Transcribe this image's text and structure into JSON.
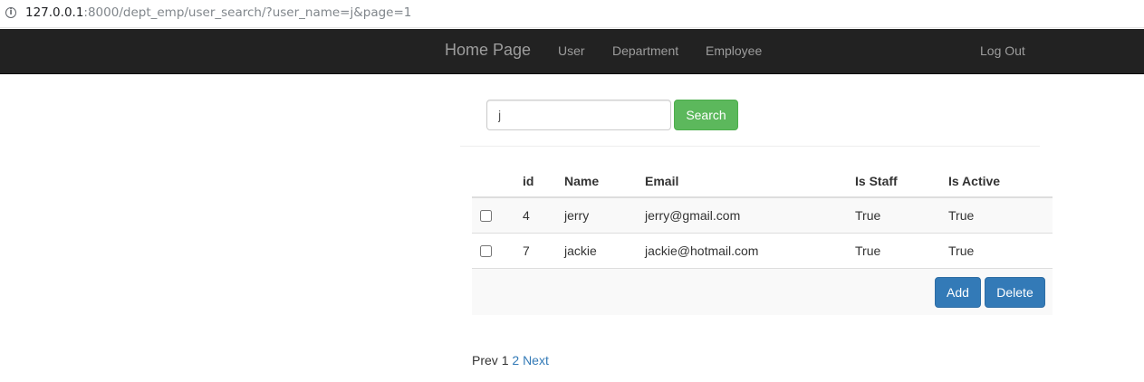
{
  "browser": {
    "url_host": "127.0.0.1",
    "url_path": ":8000/dept_emp/user_search/?user_name=j&page=1",
    "info_icon": "i"
  },
  "navbar": {
    "brand": "Home Page",
    "links": [
      "User",
      "Department",
      "Employee"
    ],
    "logout": "Log Out"
  },
  "search": {
    "value": "j",
    "button": "Search"
  },
  "table": {
    "columns": [
      "id",
      "Name",
      "Email",
      "Is Staff",
      "Is Active"
    ],
    "rows": [
      {
        "id": "4",
        "name": "jerry",
        "email": "jerry@gmail.com",
        "is_staff": "True",
        "is_active": "True"
      },
      {
        "id": "7",
        "name": "jackie",
        "email": "jackie@hotmail.com",
        "is_staff": "True",
        "is_active": "True"
      }
    ]
  },
  "actions": {
    "add": "Add",
    "delete": "Delete"
  },
  "pagination": {
    "prev": "Prev",
    "current": "1",
    "next_page": "2",
    "next": "Next"
  },
  "colors": {
    "navbar_bg": "#222222",
    "success": "#5cb85c",
    "primary": "#337ab7",
    "link": "#337ab7"
  }
}
